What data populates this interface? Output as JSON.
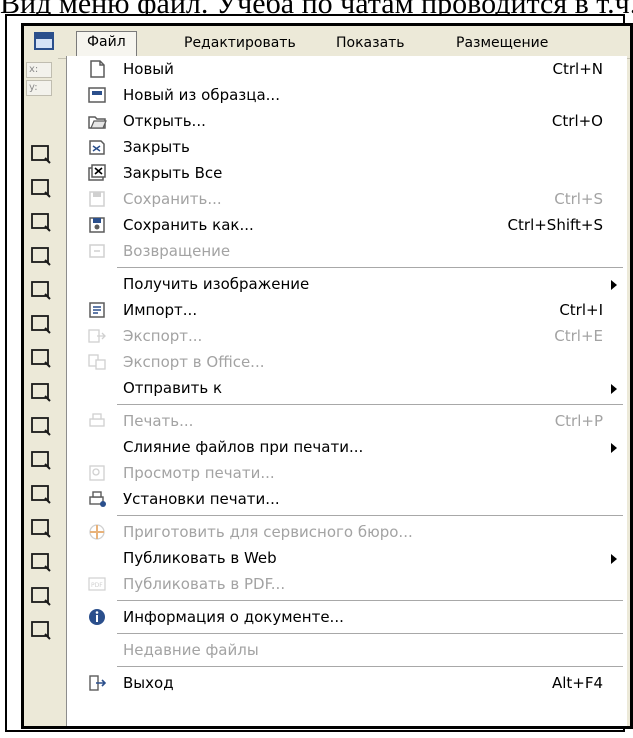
{
  "caption": "Вид меню файл. Учеба по чатам проводится в т.ч. в КСС",
  "menubar": {
    "items": [
      {
        "label": "Файл",
        "active": true
      },
      {
        "label": "Редактировать"
      },
      {
        "label": "Показать"
      },
      {
        "label": "Размещение"
      }
    ]
  },
  "toolbox": {
    "coord_x": "x:",
    "coord_y": "y:",
    "tools": [
      "pointer-icon",
      "shape-icon",
      "zoom-icon",
      "freehand-icon",
      "smart-fill-icon",
      "rectangle-icon",
      "ellipse-icon",
      "table-icon",
      "polygon-icon",
      "text-icon",
      "interactive-icon",
      "eyedropper-icon",
      "outline-pen-icon",
      "fill-icon",
      "interactive-fill-icon"
    ]
  },
  "menu": {
    "items": [
      {
        "type": "item",
        "label": "Новый",
        "shortcut": "Ctrl+N",
        "icon": "new-document-icon",
        "enabled": true
      },
      {
        "type": "item",
        "label": "Новый из образца...",
        "shortcut": "",
        "icon": "new-from-template-icon",
        "enabled": true
      },
      {
        "type": "item",
        "label": "Открыть...",
        "shortcut": "Ctrl+O",
        "icon": "open-icon",
        "enabled": true
      },
      {
        "type": "item",
        "label": "Закрыть",
        "shortcut": "",
        "icon": "close-document-icon",
        "enabled": true
      },
      {
        "type": "item",
        "label": "Закрыть Все",
        "shortcut": "",
        "icon": "close-all-icon",
        "enabled": true
      },
      {
        "type": "item",
        "label": "Сохранить...",
        "shortcut": "Ctrl+S",
        "icon": "save-icon",
        "enabled": false
      },
      {
        "type": "item",
        "label": "Сохранить как...",
        "shortcut": "Ctrl+Shift+S",
        "icon": "save-as-icon",
        "enabled": true
      },
      {
        "type": "item",
        "label": "Возвращение",
        "shortcut": "",
        "icon": "revert-icon",
        "enabled": false
      },
      {
        "type": "sep"
      },
      {
        "type": "item",
        "label": "Получить изображение",
        "shortcut": "",
        "icon": "",
        "enabled": true,
        "submenu": true
      },
      {
        "type": "item",
        "label": "Импорт...",
        "shortcut": "Ctrl+I",
        "icon": "import-icon",
        "enabled": true
      },
      {
        "type": "item",
        "label": "Экспорт...",
        "shortcut": "Ctrl+E",
        "icon": "export-icon",
        "enabled": false
      },
      {
        "type": "item",
        "label": "Экспорт в Office...",
        "shortcut": "",
        "icon": "export-office-icon",
        "enabled": false
      },
      {
        "type": "item",
        "label": "Отправить к",
        "shortcut": "",
        "icon": "",
        "enabled": true,
        "submenu": true
      },
      {
        "type": "sep"
      },
      {
        "type": "item",
        "label": "Печать...",
        "shortcut": "Ctrl+P",
        "icon": "print-icon",
        "enabled": false
      },
      {
        "type": "item",
        "label": "Слияние файлов при печати...",
        "shortcut": "",
        "icon": "",
        "enabled": true,
        "submenu": true
      },
      {
        "type": "item",
        "label": "Просмотр печати...",
        "shortcut": "",
        "icon": "print-preview-icon",
        "enabled": false
      },
      {
        "type": "item",
        "label": "Установки печати...",
        "shortcut": "",
        "icon": "print-setup-icon",
        "enabled": true
      },
      {
        "type": "sep"
      },
      {
        "type": "item",
        "label": "Приготовить для сервисного бюро...",
        "shortcut": "",
        "icon": "prepare-service-bureau-icon",
        "enabled": false
      },
      {
        "type": "item",
        "label": "Публиковать в Web",
        "shortcut": "",
        "icon": "",
        "enabled": true,
        "submenu": true
      },
      {
        "type": "item",
        "label": "Публиковать в PDF...",
        "shortcut": "",
        "icon": "pdf-icon",
        "enabled": false
      },
      {
        "type": "sep"
      },
      {
        "type": "item",
        "label": "Информация о документе...",
        "shortcut": "",
        "icon": "info-icon",
        "enabled": true
      },
      {
        "type": "sep"
      },
      {
        "type": "item",
        "label": "Недавние файлы",
        "shortcut": "",
        "icon": "",
        "enabled": false
      },
      {
        "type": "sep"
      },
      {
        "type": "item",
        "label": "Выход",
        "shortcut": "Alt+F4",
        "icon": "exit-icon",
        "enabled": true
      }
    ]
  },
  "colors": {
    "menu_bg": "#ffffff",
    "chrome": "#ece9d8",
    "disabled_text": "#a3a3a3",
    "icon_blue": "#2b4f8c"
  }
}
